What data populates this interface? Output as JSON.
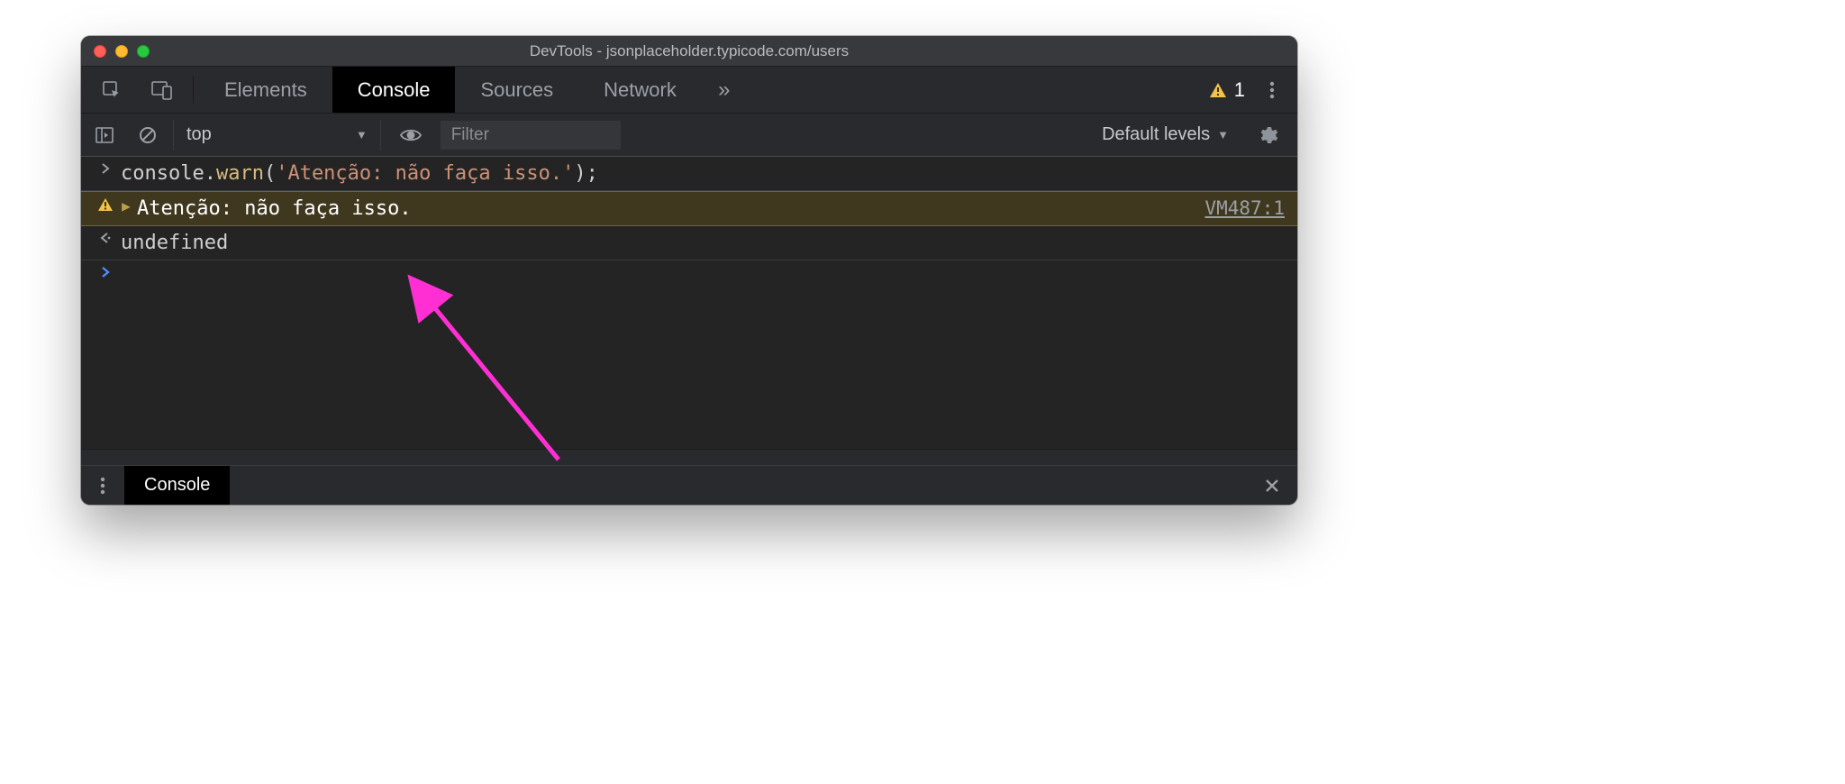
{
  "window": {
    "title": "DevTools - jsonplaceholder.typicode.com/users"
  },
  "tabs": {
    "elements": "Elements",
    "console": "Console",
    "sources": "Sources",
    "network": "Network",
    "warn_count": "1"
  },
  "toolbar": {
    "context": "top",
    "filter_placeholder": "Filter",
    "levels": "Default levels"
  },
  "console": {
    "input_prefix": "console.",
    "input_fn": "warn",
    "input_mid": "(",
    "input_str": "'Atenção: não faça isso.'",
    "input_suffix": ");",
    "warn_text": "Atenção: não faça isso.",
    "warn_src": "VM487:1",
    "result": "undefined"
  },
  "drawer": {
    "label": "Console"
  }
}
